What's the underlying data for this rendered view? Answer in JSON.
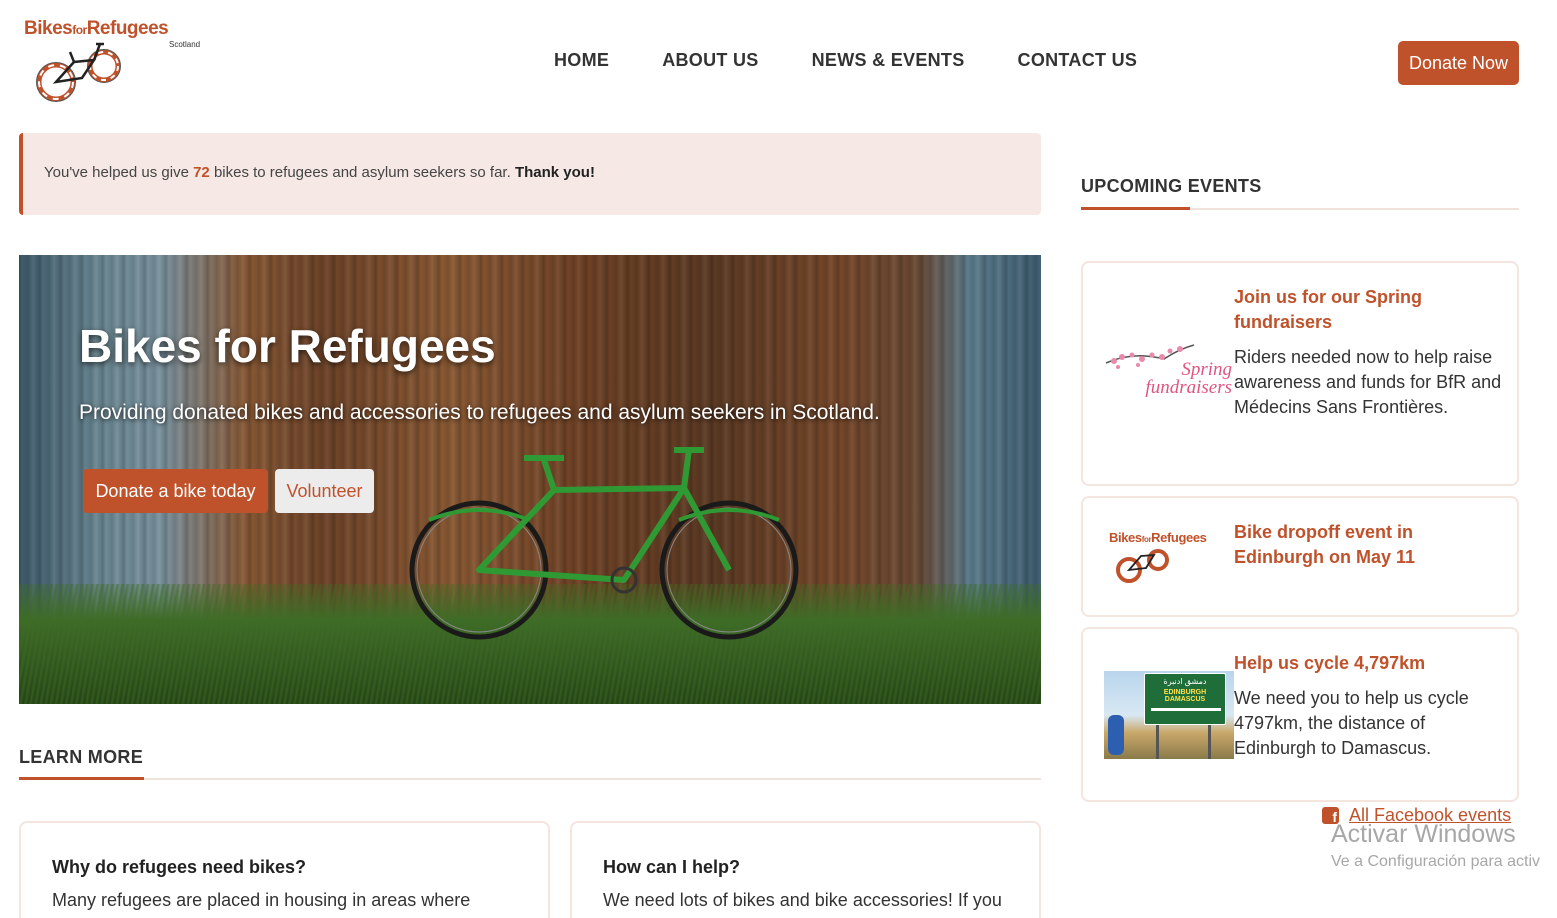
{
  "header": {
    "logo": {
      "text_a": "Bikes",
      "text_for": "for",
      "text_b": "Refugees",
      "sub": "Scotland"
    },
    "nav": [
      "HOME",
      "ABOUT US",
      "NEWS & EVENTS",
      "CONTACT US"
    ],
    "donate_label": "Donate Now"
  },
  "alert": {
    "prefix": "You've helped us give ",
    "count": "72",
    "suffix": " bikes to refugees and asylum seekers so far. ",
    "thanks": "Thank you!"
  },
  "hero": {
    "title": "Bikes for Refugees",
    "subtitle": "Providing donated bikes and accessories to refugees and asylum seekers in Scotland.",
    "donate_bike_label": "Donate a bike today",
    "volunteer_label": "Volunteer"
  },
  "learn_more": {
    "title": "LEARN MORE",
    "cards": [
      {
        "title": "Why do refugees need bikes?",
        "text": "Many refugees are placed in housing in areas where"
      },
      {
        "title": "How can I help?",
        "text": "We need lots of bikes and bike accessories! If you"
      }
    ]
  },
  "events": {
    "title": "UPCOMING EVENTS",
    "items": [
      {
        "title": "Join us for our Spring fundraisers",
        "desc": "Riders needed now to help raise awareness and funds for BfR and Médecins Sans Frontières.",
        "image_text_a": "Spring",
        "image_text_b": "fundraisers"
      },
      {
        "title": "Bike dropoff event in Edinburgh on May 11",
        "desc": ""
      },
      {
        "title": "Help us cycle 4,797km",
        "desc": "We need you to help us cycle 4797km, the distance of Edinburgh to Damascus.",
        "sign_top": "دمشق  ادنبرة",
        "sign_bottom": "EDINBURGH DAMASCUS"
      }
    ],
    "facebook_label": "All Facebook events"
  },
  "watermark": {
    "line1": "Activar Windows",
    "line2": "Ve a Configuración para activ"
  },
  "colors": {
    "accent": "#c0522b",
    "alert_bg": "#f6e9e5",
    "card_border": "#f4e5df"
  }
}
